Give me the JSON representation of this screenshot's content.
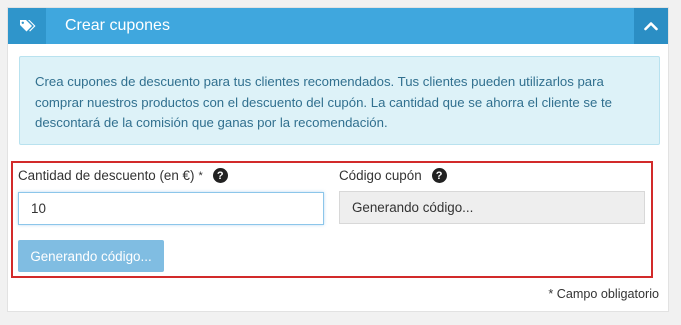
{
  "header": {
    "title": "Crear cupones",
    "tag_icon": "tags-icon",
    "collapse_icon": "chevron-up-icon"
  },
  "info": {
    "line1": "Crea cupones de descuento para tus clientes recomendados. Tus clientes pueden utilizarlos para",
    "line2": "comprar nuestros productos con el descuento del cupón. La cantidad que se ahorra el cliente se te",
    "line3": "descontará de la comisión que ganas por la recomendación."
  },
  "form": {
    "discount_label": "Cantidad de descuento (en €)",
    "required_mark": "*",
    "discount_value": "10",
    "code_label": "Código cupón",
    "code_value": "Generando código...",
    "help_icon": "question-circle-icon",
    "generate_button": "Generando código..."
  },
  "footer": {
    "required_note": "* Campo obligatorio"
  },
  "colors": {
    "header_bg": "#3fa7de",
    "info_bg": "#ddf2f8",
    "info_text": "#31708f",
    "highlight_border": "#d22a2a",
    "button_bg": "#80bde2"
  }
}
